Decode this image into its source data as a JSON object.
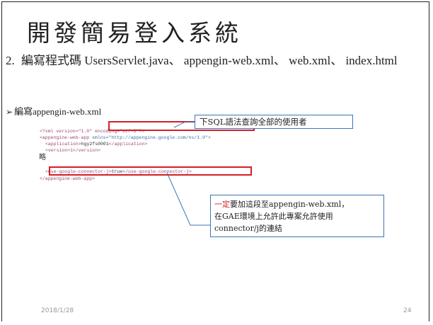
{
  "slide": {
    "title": "開發簡易登入系統",
    "item_number": "2.",
    "item_text": "編寫程式碼 UsersServlet.java、 appengin-web.xml、 web.xml、 index.html",
    "bullet_marker": "➢",
    "bullet_text": "編寫appengin-web.xml",
    "footer_date": "2018/1/28",
    "footer_page": "24"
  },
  "code": {
    "line1": "<?xml version=\"1.0\" encoding=\"utf-8\"?>",
    "line2_tag": "<appengine-web-app",
    "line2_attr": "xmlns=\"http://appengine.google.com/ns/1.0\">",
    "line3_open": "<application>",
    "line3_val": "hgy2fs0001",
    "line3_close": "</application>",
    "line4": "<version>1</version>",
    "omitted": "略",
    "line5_open": "<use-google-connector-j>",
    "line5_val": "true",
    "line5_close": "</use-google-connector-j>",
    "line6": "</appengine-web-app>"
  },
  "callouts": {
    "top": "下SQL語法查詢全部的使用者",
    "bottom_red": "一定",
    "bottom_line1": "要加這段至appengin-web.xml，",
    "bottom_line2": "在GAE環境上允許此專案允許使用",
    "bottom_line3": "connector/j的連結"
  },
  "colors": {
    "highlight_red": "#d31f26",
    "callout_border": "#3b74b8"
  }
}
